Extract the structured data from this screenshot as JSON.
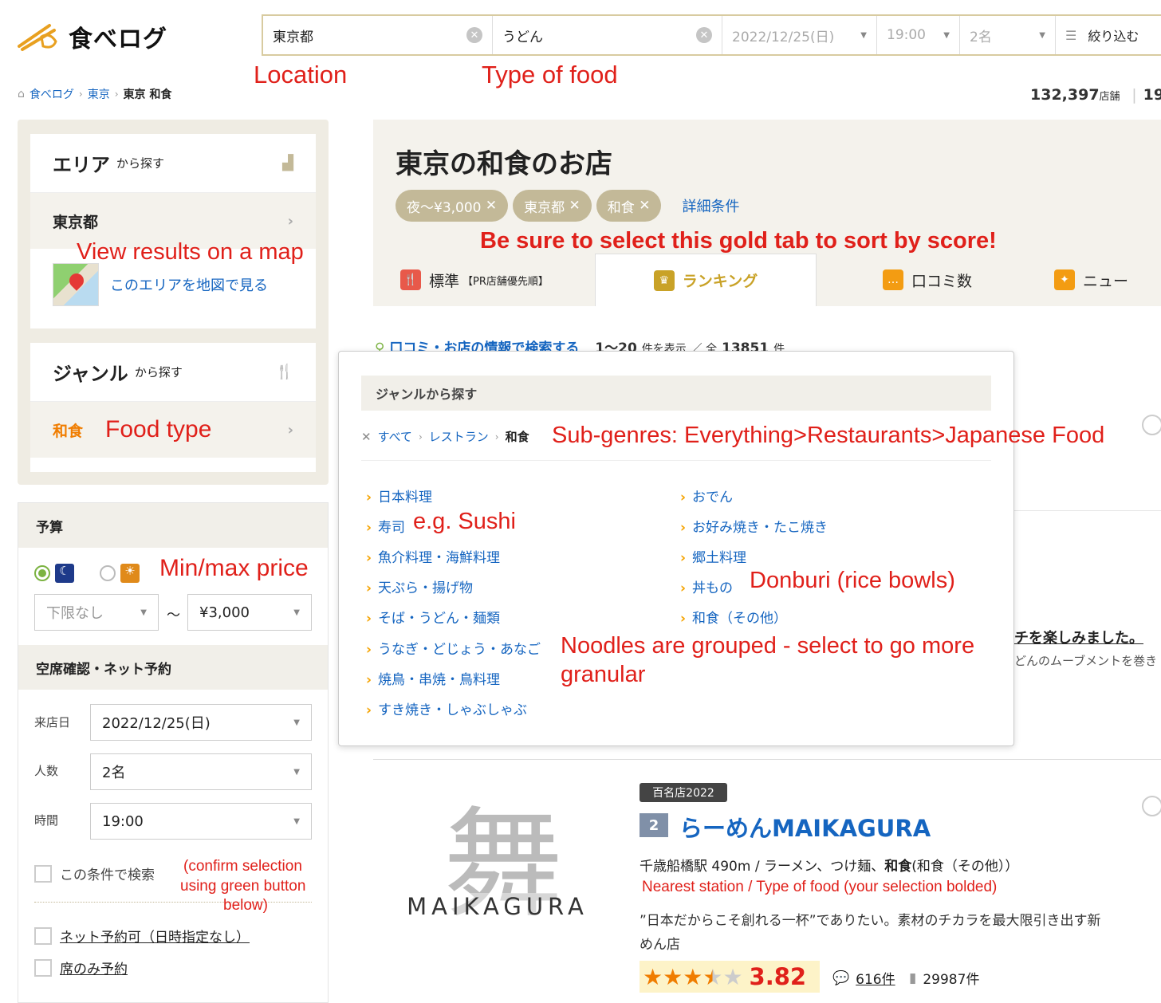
{
  "logo": {
    "text": "食べログ"
  },
  "search": {
    "location": "東京都",
    "food": "うどん",
    "date": "2022/12/25(日)",
    "time": "19:00",
    "people": "2名",
    "filter": "絞り込む"
  },
  "notes": {
    "location": "Location",
    "food": "Type of food",
    "map": "View results on a map",
    "foodtype": "Food type",
    "price": "Min/max price",
    "gold": "Be sure to select this gold tab to sort by score!",
    "subgenres": "Sub-genres: Everything>Restaurants>Japanese Food",
    "sushi": "e.g. Sushi",
    "donburi": "Donburi (rice bowls)",
    "noodles1": "Noodles are grouped - select to go more",
    "noodles2": "granular",
    "confirm1": "(confirm selection",
    "confirm2": "using green button",
    "confirm3": "below)",
    "nearest": "Nearest station / Type of food (your selection bolded)"
  },
  "breadcrumb": {
    "home": "食べログ",
    "area": "東京",
    "current": "東京 和食"
  },
  "counts": {
    "shops": "132,397",
    "shops_unit": "店舗",
    "other": "19,"
  },
  "sidebar": {
    "area_title": "エリア",
    "area_suffix": "から探す",
    "area_value": "東京都",
    "map_link": "このエリアを地図で見る",
    "genre_title": "ジャンル",
    "genre_suffix": "から探す",
    "genre_value": "和食"
  },
  "budget": {
    "title": "予算",
    "min": "下限なし",
    "tilde": "〜",
    "max": "¥3,000",
    "reserve_title": "空席確認・ネット予約",
    "date_label": "来店日",
    "date": "2022/12/25(日)",
    "people_label": "人数",
    "people": "2名",
    "time_label": "時間",
    "time": "19:00",
    "search_cond": "この条件で検索",
    "net_reserve": "ネット予約可（日時指定なし）",
    "seat_only": "席のみ予約"
  },
  "main": {
    "title": "東京の和食のお店",
    "tags": [
      "夜〜¥3,000",
      "東京都",
      "和食"
    ],
    "detail": "詳細条件",
    "tabs": [
      "標準",
      "【PR店舗優先順】",
      "ランキング",
      "口コミ数",
      "ニュー"
    ],
    "search_link": "口コミ・お店の情報で検索する",
    "range": "1〜20",
    "range_suffix": "件を表示",
    "total_prefix": "／ 全",
    "total": "13851",
    "total_suffix": "件"
  },
  "popup": {
    "title": "ジャンルから探す",
    "crumbs": [
      "すべて",
      "レストラン",
      "和食"
    ],
    "left": [
      "日本料理",
      "寿司",
      "魚介料理・海鮮料理",
      "天ぷら・揚げ物",
      "そば・うどん・麺類",
      "うなぎ・どじょう・あなご",
      "焼鳥・串焼・鳥料理",
      "すき焼き・しゃぶしゃぶ"
    ],
    "right": [
      "おでん",
      "お好み焼き・たこ焼き",
      "郷土料理",
      "丼もの",
      "和食（その他）"
    ]
  },
  "peek": {
    "text1": "チを楽しみました。",
    "text2": "どんのムーブメントを巻き"
  },
  "listing": {
    "badge": "百名店2022",
    "rank": "2",
    "name": "らーめんMAIKAGURA",
    "logo_text": "MAIKAGURA",
    "info_prefix": "千歳船橋駅 490m / ラーメン、つけ麺、",
    "info_bold": "和食",
    "info_suffix": "(和食（その他））",
    "desc": "”日本だからこそ創れる一杯”でありたい。素材のチカラを最大限引き出す新",
    "desc2": "めん店",
    "score": "3.82",
    "score_value": 3.82,
    "reviews": "616件",
    "saves": "29987件"
  },
  "colors": {
    "accent": "#c9a227",
    "link": "#1565c0",
    "note": "#e0201a",
    "score": "#e0201a"
  }
}
